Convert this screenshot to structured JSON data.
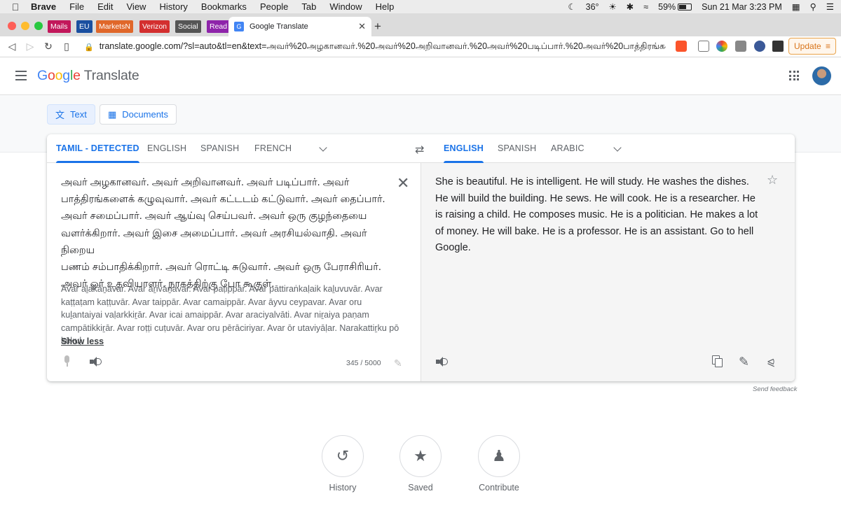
{
  "menubar": {
    "app": "Brave",
    "items": [
      "File",
      "Edit",
      "View",
      "History",
      "Bookmarks",
      "People",
      "Tab",
      "Window",
      "Help"
    ],
    "status": {
      "temperature": "36°",
      "battery": "59%",
      "battery_fill": 0.59,
      "datetime": "Sun 21 Mar  3:23 PM"
    }
  },
  "bookmarks": [
    {
      "label": "Mails",
      "color": "#c2185b"
    },
    {
      "label": "EU",
      "color": "#1a4fa0"
    },
    {
      "label": "MarketsN",
      "color": "#e0672a"
    },
    {
      "label": "Verizon",
      "color": "#d32f2f"
    },
    {
      "label": "Social",
      "color": "#555555"
    },
    {
      "label": "Read",
      "color": "#8e24aa"
    }
  ],
  "tab": {
    "title": "Google Translate"
  },
  "address": {
    "url": "translate.google.com/?sl=auto&tl=en&text=அவர்%20அழகானவர்.%20அவர்%20அறிவானவர்.%20அவர்%20படிப்பார்.%20அவர்%20பாத்திரங்களைக்%20க..."
  },
  "toolbar": {
    "update_label": "Update"
  },
  "header": {
    "logo_letters": [
      "G",
      "o",
      "o",
      "g",
      "l",
      "e"
    ],
    "product": "Translate"
  },
  "modes": [
    {
      "label": "Text",
      "active": true
    },
    {
      "label": "Documents",
      "active": false
    }
  ],
  "source_langs": [
    "TAMIL - DETECTED",
    "ENGLISH",
    "SPANISH",
    "FRENCH"
  ],
  "target_langs": [
    "ENGLISH",
    "SPANISH",
    "ARABIC"
  ],
  "source": {
    "text": "அவர் அழகானவர். அவர் அறிவானவர். அவர் படிப்பார். அவர்\nபாத்திரங்களைக் கழுவுவார். அவர் கட்டடம் கட்டுவார். அவர் தைப்பார்.\nஅவர் சமைப்பார். அவர் ஆய்வு செய்பவர். அவர் ஒரு குழந்தையை\nவளர்க்கிறார். அவர் இசை அமைப்பார். அவர் அரசியல்வாதி. அவர் நிறைய\nபணம் சம்பாதிக்கிறார். அவர் ரொட்டி சுடுவார். அவர் ஒரு பேராசிரியர்.\nஅவர் ஓர் உதவியாளர். நரகத்திற்கு போ கூகுள்.",
    "transliteration": "Avar aḻakāṉavar. Avar aṟivāṉavar. Avar paṭippār. Avar pāttiraṅkaḷaik kaḻuvuvār. Avar kaṭṭaṭam kaṭṭuvār. Avar taippār. Avar camaippār. Avar āyvu ceypavar. Avar oru kuḻantaiyai vaḷarkkiṟār. Avar icai amaippār. Avar araciyalvāti. Avar niṟaiya paṇam campātikkiṟār. Avar roṭṭi cuṭuvār. Avar oru pērāciriyar. Avar ōr utaviyāḷar. Narakattiṟku pō kūkuḷ.",
    "show_less": "Show less",
    "counter": "345 / 5000"
  },
  "target": {
    "text": "She is beautiful. He is intelligent. He will study. He washes the dishes. He will build the building. He sews. He will cook. He is a researcher. He is raising a child. He composes music. He is a politician. He makes a lot of money. He will bake. He is a professor. He is an assistant. Go to hell Google."
  },
  "feedback": "Send feedback",
  "actions": [
    {
      "label": "History",
      "icon": "history-icon"
    },
    {
      "label": "Saved",
      "icon": "star-icon"
    },
    {
      "label": "Contribute",
      "icon": "contribute-icon"
    }
  ],
  "colors": {
    "accent": "#1a73e8",
    "icon": "#5f6368"
  }
}
